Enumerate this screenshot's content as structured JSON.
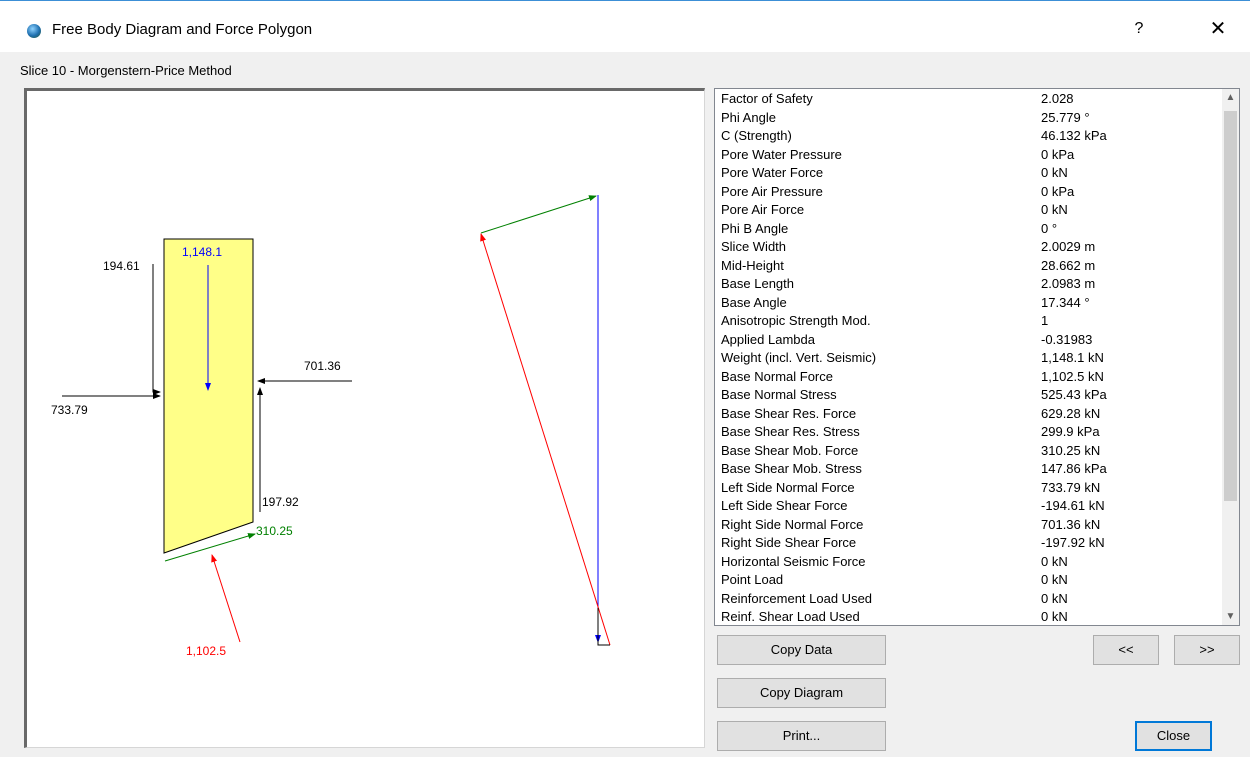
{
  "window": {
    "title": "Free Body Diagram and Force Polygon",
    "help_label": "?",
    "close_label": "✕"
  },
  "subtitle": "Slice  10 - Morgenstern-Price  Method",
  "diagram": {
    "left_shear": "194.61",
    "weight": "1,148.1",
    "right_normal": "701.36",
    "left_normal": "733.79",
    "right_shear": "197.92",
    "base_shear": "310.25",
    "base_normal": "1,102.5",
    "colors": {
      "slice_fill": "#ffff88",
      "weight": "#0000ff",
      "shear": "#008000",
      "normal": "#ff0000",
      "side_forces": "#000000"
    }
  },
  "properties": [
    {
      "label": "Factor of Safety",
      "value": "2.028"
    },
    {
      "label": "Phi Angle",
      "value": "25.779 °"
    },
    {
      "label": "C (Strength)",
      "value": "46.132 kPa"
    },
    {
      "label": "Pore Water Pressure",
      "value": "0 kPa"
    },
    {
      "label": "Pore Water Force",
      "value": "0 kN"
    },
    {
      "label": "Pore Air Pressure",
      "value": "0 kPa"
    },
    {
      "label": "Pore Air Force",
      "value": "0 kN"
    },
    {
      "label": "Phi B Angle",
      "value": "0 °"
    },
    {
      "label": "Slice Width",
      "value": "2.0029 m"
    },
    {
      "label": "Mid-Height",
      "value": "28.662 m"
    },
    {
      "label": "Base Length",
      "value": "2.0983 m"
    },
    {
      "label": "Base Angle",
      "value": "17.344 °"
    },
    {
      "label": "Anisotropic Strength Mod.",
      "value": "1"
    },
    {
      "label": "Applied Lambda",
      "value": "-0.31983"
    },
    {
      "label": "Weight (incl. Vert. Seismic)",
      "value": "1,148.1 kN"
    },
    {
      "label": "Base Normal Force",
      "value": "1,102.5 kN"
    },
    {
      "label": "Base Normal Stress",
      "value": "525.43 kPa"
    },
    {
      "label": "Base Shear Res. Force",
      "value": "629.28 kN"
    },
    {
      "label": "Base Shear Res. Stress",
      "value": "299.9 kPa"
    },
    {
      "label": "Base Shear Mob. Force",
      "value": "310.25 kN"
    },
    {
      "label": "Base Shear Mob. Stress",
      "value": "147.86 kPa"
    },
    {
      "label": "Left Side Normal Force",
      "value": "733.79 kN"
    },
    {
      "label": "Left Side Shear Force",
      "value": "-194.61 kN"
    },
    {
      "label": "Right Side Normal Force",
      "value": "701.36 kN"
    },
    {
      "label": "Right Side Shear Force",
      "value": "-197.92 kN"
    },
    {
      "label": "Horizontal Seismic Force",
      "value": "0 kN"
    },
    {
      "label": "Point Load",
      "value": "0 kN"
    },
    {
      "label": "Reinforcement Load Used",
      "value": "0 kN"
    },
    {
      "label": "Reinf. Shear Load Used",
      "value": "0 kN"
    }
  ],
  "scroll": {
    "up": "▲",
    "down": "▼"
  },
  "buttons": {
    "copy_data": "Copy Data",
    "copy_diagram": "Copy Diagram",
    "print": "Print...",
    "prev": "<<",
    "next": ">>",
    "close": "Close"
  }
}
